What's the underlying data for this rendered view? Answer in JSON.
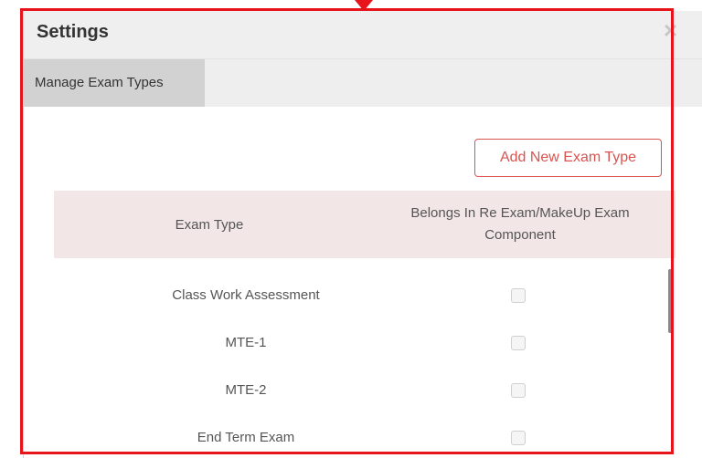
{
  "modal": {
    "title": "Settings",
    "close_glyph": "×"
  },
  "tabs": [
    {
      "label": "Manage Exam Types",
      "active": true
    }
  ],
  "actions": {
    "add_label": "Add New Exam Type"
  },
  "table": {
    "columns": [
      "Exam Type",
      "Belongs In Re Exam/MakeUp Exam Component"
    ],
    "rows": [
      {
        "name": "Class Work Assessment",
        "checked": false
      },
      {
        "name": "MTE-1",
        "checked": false
      },
      {
        "name": "MTE-2",
        "checked": false
      },
      {
        "name": "End Term Exam",
        "checked": false
      }
    ]
  },
  "colors": {
    "accent": "#d9534f",
    "annotation": "#e8141b",
    "header_row_bg": "#f2e7e6"
  },
  "icons": {
    "close": "close-icon",
    "annotation_arrow": "arrow-down-icon"
  }
}
